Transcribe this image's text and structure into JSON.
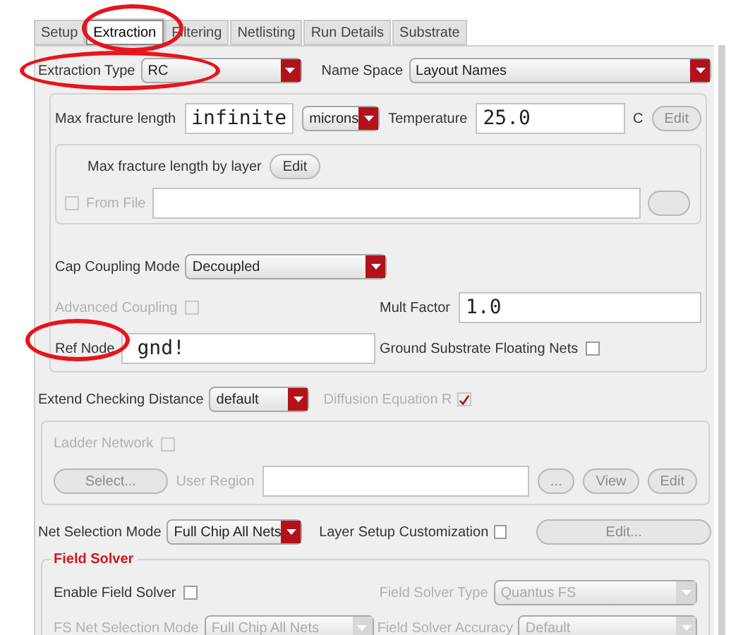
{
  "tabs": [
    {
      "label": "Setup",
      "selected": false
    },
    {
      "label": "Extraction",
      "selected": true
    },
    {
      "label": "Filtering",
      "selected": false
    },
    {
      "label": "Netlisting",
      "selected": false
    },
    {
      "label": "Run Details",
      "selected": false
    },
    {
      "label": "Substrate",
      "selected": false
    }
  ],
  "extraction_type": {
    "label": "Extraction Type",
    "value": "RC"
  },
  "name_space": {
    "label": "Name Space",
    "value": "Layout Names"
  },
  "fracture": {
    "label": "Max fracture length",
    "value": "infinite",
    "unit": "microns",
    "temperature_label": "Temperature",
    "temperature_value": "25.0",
    "temperature_unit": "C",
    "edit_button": {
      "label": "Edit",
      "disabled": true
    }
  },
  "by_layer": {
    "label": "Max fracture length by layer",
    "edit_button": {
      "label": "Edit",
      "disabled": false
    }
  },
  "from_file": {
    "label": "From File",
    "checked": false,
    "disabled": true
  },
  "cap_coupling": {
    "label": "Cap Coupling Mode",
    "value": "Decoupled"
  },
  "advanced_coupling": {
    "label": "Advanced Coupling",
    "checked": false,
    "disabled": true
  },
  "mult_factor": {
    "label": "Mult Factor",
    "value": "1.0"
  },
  "ref_node": {
    "label": "Ref Node",
    "value": "gnd!"
  },
  "ground_substrate": {
    "label": "Ground Substrate Floating Nets",
    "checked": false,
    "disabled": false
  },
  "extend_checking": {
    "label": "Extend Checking Distance",
    "value": "default"
  },
  "diffusion": {
    "label": "Diffusion Equation R",
    "checked": true,
    "disabled": true
  },
  "ladder_network": {
    "label": "Ladder Network",
    "checked": false,
    "disabled": true
  },
  "user_region": {
    "select_button": "Select...",
    "label": "User Region",
    "browse_button": "...",
    "view_button": "View",
    "edit_button": "Edit",
    "disabled": true
  },
  "net_selection": {
    "label": "Net Selection Mode",
    "value": "Full Chip All Nets"
  },
  "layer_setup": {
    "label": "Layer Setup Customization",
    "checked": false,
    "disabled": false,
    "edit_button": "Edit..."
  },
  "field_solver": {
    "title": "Field Solver",
    "enable": {
      "label": "Enable Field Solver",
      "checked": false,
      "disabled": false
    },
    "type": {
      "label": "Field Solver Type",
      "value": "Quantus FS",
      "disabled": true
    },
    "net_mode": {
      "label": "FS Net Selection Mode",
      "value": "Full Chip All Nets",
      "disabled": true
    },
    "accuracy": {
      "label": "Field Solver Accuracy",
      "value": "Default",
      "disabled": true
    }
  },
  "annotations": [
    {
      "kind": "ellipse"
    },
    {
      "kind": "ellipse"
    },
    {
      "kind": "ellipse"
    }
  ]
}
